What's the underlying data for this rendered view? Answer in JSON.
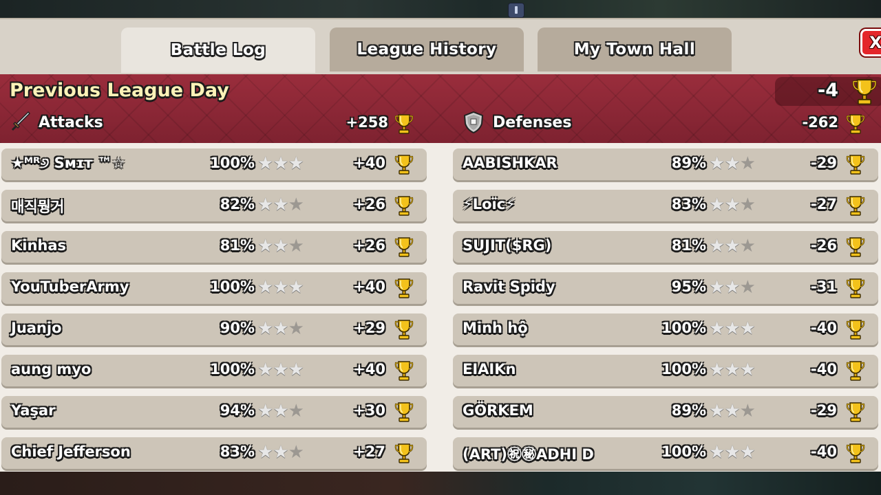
{
  "tabs": [
    {
      "label": "Battle Log",
      "active": true
    },
    {
      "label": "League History",
      "active": false
    },
    {
      "label": "My Town Hall",
      "active": false
    }
  ],
  "close_label": "X",
  "banner": {
    "title": "Previous League Day",
    "total": "-4",
    "attacks_label": "Attacks",
    "attacks_total": "+258",
    "defenses_label": "Defenses",
    "defenses_total": "-262"
  },
  "attacks": [
    {
      "name": "★ᴹᴿ୬ Sᴍɪᴛ ™☆",
      "percent": "100%",
      "stars": 3,
      "trophies": "+40"
    },
    {
      "name": "매직뭥거",
      "percent": "82%",
      "stars": 2,
      "trophies": "+26"
    },
    {
      "name": "Kinhas",
      "percent": "81%",
      "stars": 2,
      "trophies": "+26"
    },
    {
      "name": "YouTuberArmy",
      "percent": "100%",
      "stars": 3,
      "trophies": "+40"
    },
    {
      "name": "Juanjo",
      "percent": "90%",
      "stars": 2,
      "trophies": "+29"
    },
    {
      "name": "aung myo",
      "percent": "100%",
      "stars": 3,
      "trophies": "+40"
    },
    {
      "name": "Yaşar",
      "percent": "94%",
      "stars": 2,
      "trophies": "+30"
    },
    {
      "name": "Chief Jefferson",
      "percent": "83%",
      "stars": 2,
      "trophies": "+27"
    }
  ],
  "defenses": [
    {
      "name": "AABISHKAR",
      "percent": "89%",
      "stars": 2,
      "trophies": "-29"
    },
    {
      "name": "⚡Loïc⚡",
      "percent": "83%",
      "stars": 2,
      "trophies": "-27"
    },
    {
      "name": "SUJIT($RG)",
      "percent": "81%",
      "stars": 2,
      "trophies": "-26"
    },
    {
      "name": "Ravit Spidy",
      "percent": "95%",
      "stars": 2,
      "trophies": "-31"
    },
    {
      "name": "Minh hộ",
      "percent": "100%",
      "stars": 3,
      "trophies": "-40"
    },
    {
      "name": "EIAIKn",
      "percent": "100%",
      "stars": 3,
      "trophies": "-40"
    },
    {
      "name": "GÖRKEM",
      "percent": "89%",
      "stars": 2,
      "trophies": "-29"
    },
    {
      "name": "(ART)㊗㊙ADHI D",
      "percent": "100%",
      "stars": 3,
      "trophies": "-40"
    }
  ],
  "icons": {
    "trophy": "trophy-icon",
    "attack": "sword-icon",
    "defense": "shield-icon",
    "star": "star-icon"
  },
  "colors": {
    "banner": "#8a2634",
    "panel": "#d8d2c8",
    "row": "#cdc5b8",
    "trophy_gold": "#f3c21b",
    "close_red": "#e4262a"
  }
}
